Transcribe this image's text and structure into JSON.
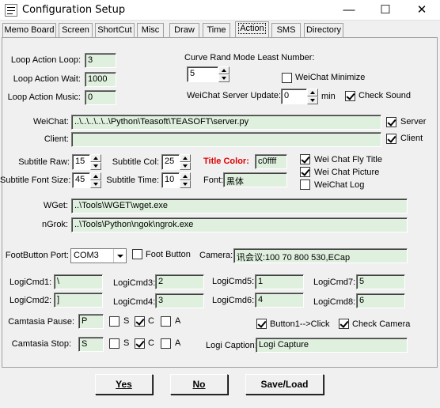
{
  "window": {
    "title": "Configuration Setup",
    "minimize": "—",
    "maximize": "☐",
    "close": "✕"
  },
  "tabs": [
    "Memo Board",
    "Screen",
    "ShortCut",
    "Misc",
    "Draw",
    "Time",
    "Action",
    "SMS",
    "Directory"
  ],
  "active_tab": "Action",
  "loop": {
    "loop_label": "Loop Action Loop:",
    "loop_value": "3",
    "wait_label": "Loop Action Wait:",
    "wait_value": "1000",
    "music_label": "Loop Action Music:",
    "music_value": "0"
  },
  "curve": {
    "label": "Curve Rand Mode Least Number:",
    "value": "5",
    "wechat_minimize_label": "WeiChat Minimize",
    "server_update_label": "WeiChat Server Update:",
    "server_update_value": "0",
    "min_label": "min",
    "check_sound_label": "Check Sound"
  },
  "wechat": {
    "label": "WeiChat:",
    "value": "..\\..\\..\\..\\..\\Python\\Teasoft\\TEASOFT\\server.py",
    "server_label": "Server",
    "client_label": "Client:",
    "client_value": "",
    "client_cb_label": "Client"
  },
  "subtitle": {
    "raw_label": "Subtitle Raw:",
    "raw_value": "15",
    "col_label": "Subtitle Col:",
    "col_value": "25",
    "title_color_label": "Title Color:",
    "title_color_value": "c0ffff",
    "font_size_label": "Subtitle Font Size:",
    "font_size_value": "45",
    "time_label": "Subtitle Time:",
    "time_value": "10",
    "font_label": "Font:",
    "font_value": "黑体",
    "fly_title_label": "Wei Chat Fly Title",
    "picture_label": "Wei Chat Picture",
    "log_label": "WeiChat Log"
  },
  "paths": {
    "wget_label": "WGet:",
    "wget_value": "..\\Tools\\WGET\\wget.exe",
    "ngrok_label": "nGrok:",
    "ngrok_value": "..\\Tools\\Python\\ngok\\ngrok.exe"
  },
  "foot": {
    "port_label": "FootButton Port:",
    "port_value": "COM3",
    "button_label": "Foot Button",
    "camera_label": "Camera:",
    "camera_value": "讯会议:100 70 800 530,ECap"
  },
  "logicmd": [
    {
      "label": "LogiCmd1:",
      "value": "\\"
    },
    {
      "label": "LogiCmd2:",
      "value": "]"
    },
    {
      "label": "LogiCmd3:",
      "value": "2"
    },
    {
      "label": "LogiCmd4:",
      "value": "3"
    },
    {
      "label": "LogiCmd5:",
      "value": "1"
    },
    {
      "label": "LogiCmd6:",
      "value": "4"
    },
    {
      "label": "LogiCmd7:",
      "value": "5"
    },
    {
      "label": "LogiCmd8:",
      "value": "6"
    }
  ],
  "camtasia": {
    "pause_label": "Camtasia Pause:",
    "pause_value": "P",
    "stop_label": "Camtasia Stop:",
    "stop_value": "S",
    "s_label": "S",
    "c_label": "C",
    "a_label": "A"
  },
  "misc": {
    "button1_label": "Button1-->Click",
    "check_camera_label": "Check Camera",
    "logi_caption_label": "Logi Caption:",
    "logi_caption_value": "Logi Capture"
  },
  "buttons": {
    "yes": "Yes",
    "no": "No",
    "save_load": "Save/Load"
  },
  "colors": {
    "field_bg": "#dff0df",
    "title_color_label": "#e00000"
  }
}
